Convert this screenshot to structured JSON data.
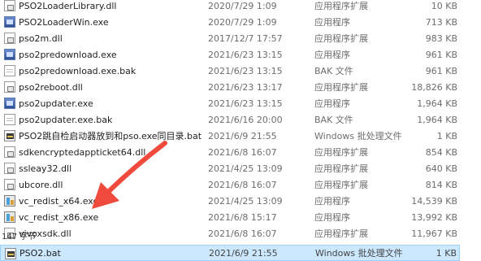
{
  "files": [
    {
      "name": "PSO2LoaderLibrary.dll",
      "date": "2020/7/29 1:09",
      "type": "应用程序扩展",
      "size": "10 KB",
      "icon": "dll-icon",
      "selected": false
    },
    {
      "name": "PSO2LoaderWin.exe",
      "date": "2020/7/29 1:09",
      "type": "应用程序",
      "size": "713 KB",
      "icon": "exe-icon",
      "selected": false
    },
    {
      "name": "pso2m.dll",
      "date": "2017/12/7 17:57",
      "type": "应用程序扩展",
      "size": "983 KB",
      "icon": "dll-icon",
      "selected": false
    },
    {
      "name": "pso2predownload.exe",
      "date": "2021/6/23 13:15",
      "type": "应用程序",
      "size": "961 KB",
      "icon": "exe-icon",
      "selected": false
    },
    {
      "name": "pso2predownload.exe.bak",
      "date": "2021/6/23 13:15",
      "type": "BAK 文件",
      "size": "961 KB",
      "icon": "file-icon",
      "selected": false
    },
    {
      "name": "pso2reboot.dll",
      "date": "2021/6/23 13:17",
      "type": "应用程序扩展",
      "size": "18,826 KB",
      "icon": "dll-icon",
      "selected": false
    },
    {
      "name": "pso2updater.exe",
      "date": "2021/6/23 13:15",
      "type": "应用程序",
      "size": "1,964 KB",
      "icon": "exe-icon",
      "selected": false
    },
    {
      "name": "pso2updater.exe.bak",
      "date": "2021/6/16 20:00",
      "type": "BAK 文件",
      "size": "1,964 KB",
      "icon": "file-icon",
      "selected": false
    },
    {
      "name": "PSO2跳自检启动器放到和pso.exe同目录.bat",
      "date": "2021/6/9 21:55",
      "type": "Windows 批处理文件",
      "size": "1 KB",
      "icon": "bat-icon",
      "selected": false
    },
    {
      "name": "sdkencryptedappticket64.dll",
      "date": "2021/6/8 16:07",
      "type": "应用程序扩展",
      "size": "854 KB",
      "icon": "dll-icon",
      "selected": false
    },
    {
      "name": "ssleay32.dll",
      "date": "2021/4/25 13:09",
      "type": "应用程序扩展",
      "size": "640 KB",
      "icon": "dll-icon",
      "selected": false
    },
    {
      "name": "ubcore.dll",
      "date": "2021/6/8 16:07",
      "type": "应用程序扩展",
      "size": "814 KB",
      "icon": "dll-icon",
      "selected": false
    },
    {
      "name": "vc_redist_x64.exe",
      "date": "2021/4/25 13:09",
      "type": "应用程序",
      "size": "14,539 KB",
      "icon": "installer-icon",
      "selected": false
    },
    {
      "name": "vc_redist_x86.exe",
      "date": "2021/6/8 15:17",
      "type": "应用程序",
      "size": "13,992 KB",
      "icon": "installer-icon",
      "selected": false
    },
    {
      "name": "vivoxsdk.dll",
      "date": "2021/6/8 16:07",
      "type": "应用程序扩展",
      "size": "11,967 KB",
      "icon": "dll-icon",
      "selected": false
    },
    {
      "name": "PSO2.bat",
      "date": "2021/6/9 21:55",
      "type": "Windows 批处理文件",
      "size": "1 KB",
      "icon": "bat-icon",
      "selected": true
    }
  ],
  "status": {
    "text": "147 字节"
  },
  "colors": {
    "selection": "#cce8ff",
    "arrow": "#f04a3c"
  }
}
